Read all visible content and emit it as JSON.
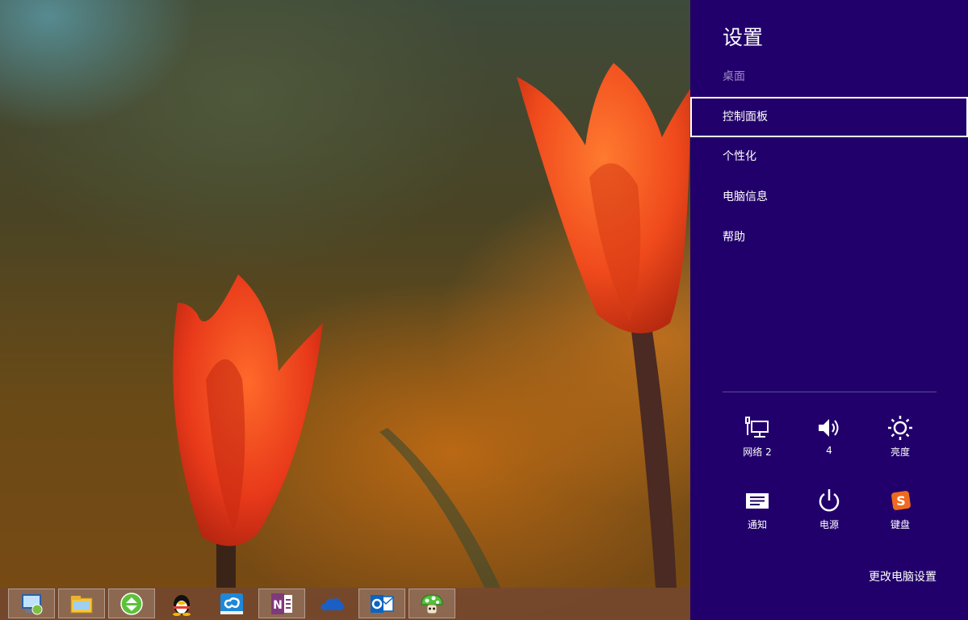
{
  "charm": {
    "title": "设置",
    "subtitle": "桌面",
    "menu": [
      {
        "label": "控制面板",
        "selected": true
      },
      {
        "label": "个性化"
      },
      {
        "label": "电脑信息"
      },
      {
        "label": "帮助"
      }
    ],
    "quick": [
      {
        "label": "网络 2",
        "icon": "network-icon"
      },
      {
        "label": "4",
        "icon": "volume-icon"
      },
      {
        "label": "亮度",
        "icon": "brightness-icon"
      },
      {
        "label": "通知",
        "icon": "notifications-icon"
      },
      {
        "label": "电源",
        "icon": "power-icon"
      },
      {
        "label": "键盘",
        "icon": "keyboard-ime-icon"
      }
    ],
    "change_settings": "更改电脑设置",
    "accent_color": "#22006b"
  },
  "taskbar": {
    "apps": [
      {
        "icon": "remote-desktop-icon"
      },
      {
        "icon": "file-explorer-icon"
      },
      {
        "icon": "refresh-green-icon"
      },
      {
        "icon": "qq-penguin-icon"
      },
      {
        "icon": "cloud-sync-icon"
      },
      {
        "icon": "onenote-icon"
      },
      {
        "icon": "onedrive-icon"
      },
      {
        "icon": "outlook-icon"
      },
      {
        "icon": "mushroom-icon"
      }
    ]
  }
}
